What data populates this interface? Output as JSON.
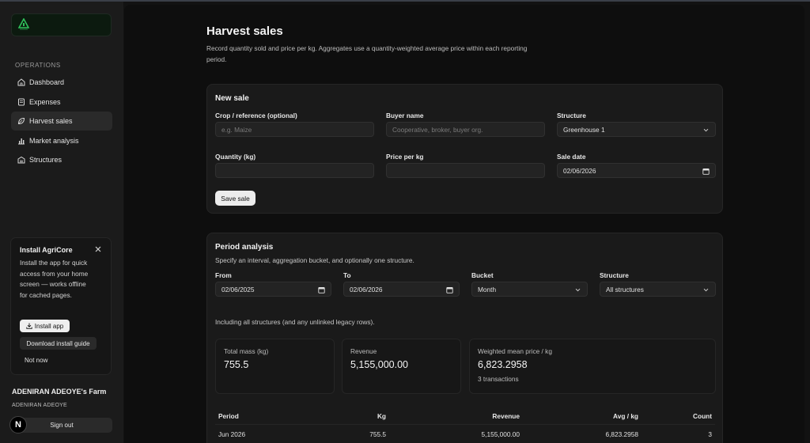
{
  "sidebar": {
    "section_label": "OPERATIONS",
    "items": [
      {
        "label": "Dashboard",
        "icon": "home-icon",
        "active": false
      },
      {
        "label": "Expenses",
        "icon": "receipt-icon",
        "active": false
      },
      {
        "label": "Harvest sales",
        "icon": "leaf-icon",
        "active": true
      },
      {
        "label": "Market analysis",
        "icon": "bar-chart-icon",
        "active": false
      },
      {
        "label": "Structures",
        "icon": "warehouse-icon",
        "active": false
      }
    ],
    "install": {
      "title": "Install AgriCore",
      "description": "Install the app for quick access from your home screen — works offline for cached pages.",
      "install_label": "Install app",
      "guide_label": "Download install guide",
      "not_now_label": "Not now"
    },
    "farm_name": "ADENIRAN ADEOYE's Farm",
    "owner": "ADENIRAN ADEOYE",
    "avatar_letter": "N",
    "sign_out_label": "Sign out"
  },
  "page": {
    "title": "Harvest sales",
    "description": "Record quantity sold and price per kg. Aggregates use a quantity-weighted average price within each reporting period."
  },
  "new_sale": {
    "title": "New sale",
    "crop_label": "Crop / reference (optional)",
    "crop_placeholder": "e.g. Maize",
    "buyer_label": "Buyer name",
    "buyer_placeholder": "Cooperative, broker, buyer org.",
    "structure_label": "Structure",
    "structure_value": "Greenhouse 1",
    "quantity_label": "Quantity (kg)",
    "quantity_value": "",
    "price_label": "Price per kg",
    "price_value": "",
    "date_label": "Sale date",
    "date_value": "02/06/2026",
    "save_label": "Save sale"
  },
  "analysis": {
    "title": "Period analysis",
    "subtitle": "Specify an interval, aggregation bucket, and optionally one structure.",
    "from_label": "From",
    "from_value": "02/06/2025",
    "to_label": "To",
    "to_value": "02/06/2026",
    "bucket_label": "Bucket",
    "bucket_value": "Month",
    "structure_label": "Structure",
    "structure_value": "All structures",
    "scope_note": "Including all structures (and any unlinked legacy rows).",
    "stats": {
      "mass_label": "Total mass (kg)",
      "mass_value": "755.5",
      "revenue_label": "Revenue",
      "revenue_value": "5,155,000.00",
      "price_label": "Weighted mean price / kg",
      "price_value": "6,823.2958",
      "tx_label": "3 transactions"
    },
    "table": {
      "headers": [
        "Period",
        "Kg",
        "Revenue",
        "Avg / kg",
        "Count"
      ],
      "rows": [
        [
          "Jun 2026",
          "755.5",
          "5,155,000.00",
          "6,823.2958",
          "3"
        ]
      ]
    }
  }
}
